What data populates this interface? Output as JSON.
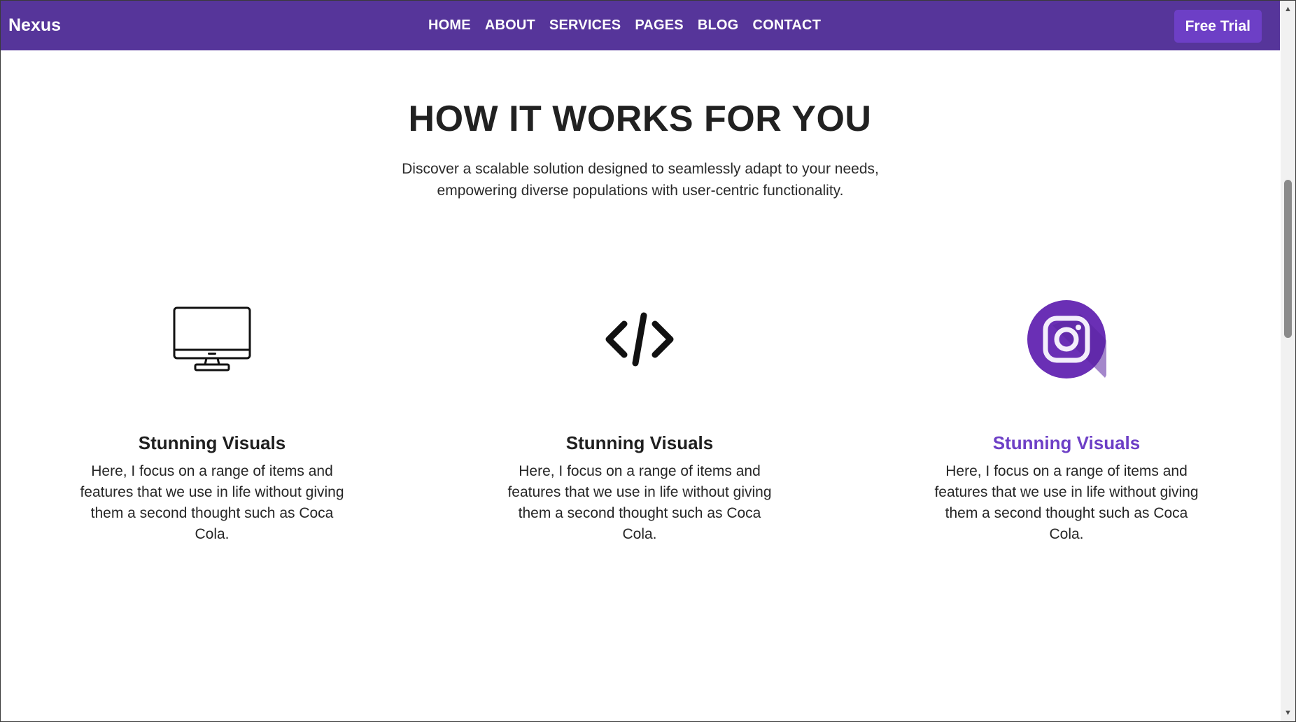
{
  "nav": {
    "brand": "Nexus",
    "links": [
      "HOME",
      "ABOUT",
      "SERVICES",
      "PAGES",
      "BLOG",
      "CONTACT"
    ],
    "cta": "Free Trial"
  },
  "hero": {
    "title": "HOW IT WORKS FOR YOU",
    "subtitle": "Discover a scalable solution designed to seamlessly adapt to your needs, empowering diverse populations with user-centric functionality."
  },
  "features": [
    {
      "icon": "monitor-icon",
      "title": "Stunning Visuals",
      "text": "Here, I focus on a range of items and features that we use in life without giving them a second thought such as Coca Cola."
    },
    {
      "icon": "code-icon",
      "title": "Stunning Visuals",
      "text": "Here, I focus on a range of items and features that we use in life without giving them a second thought such as Coca Cola."
    },
    {
      "icon": "instagram-icon",
      "title": "Stunning Visuals",
      "text": "Here, I focus on a range of items and features that we use in life without giving them a second thought such as Coca Cola."
    }
  ],
  "colors": {
    "navbar": "#56359a",
    "accent": "#6d3fc6",
    "text": "#212121"
  }
}
